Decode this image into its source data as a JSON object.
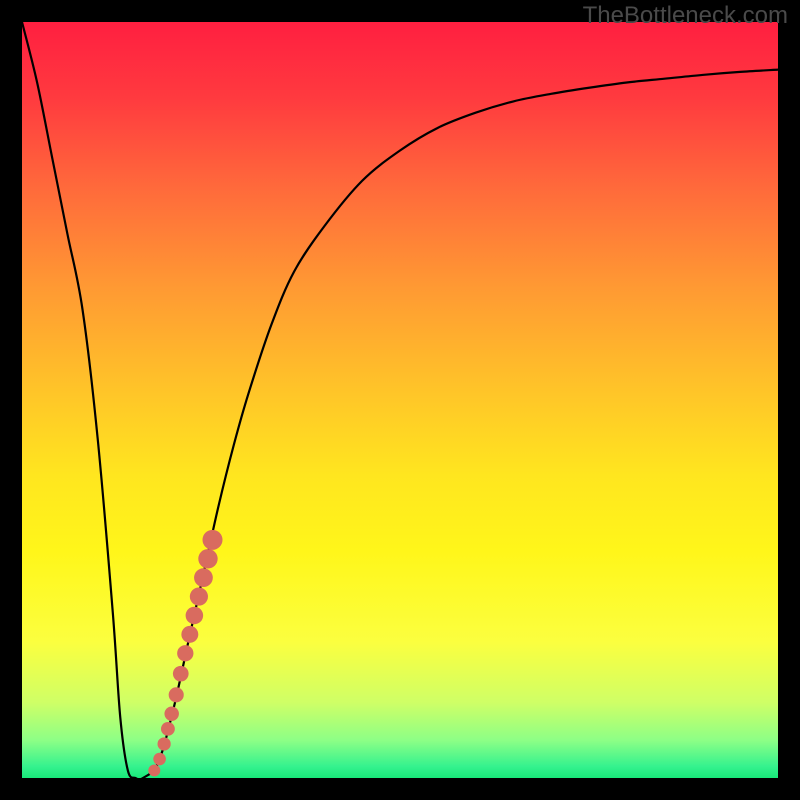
{
  "watermark": "TheBottleneck.com",
  "colors": {
    "page_bg": "#000000",
    "watermark": "#4a4a4a",
    "curve": "#000000",
    "marker": "#d96b5f",
    "gradient_stops": [
      {
        "offset": 0.0,
        "color": "#ff1f40"
      },
      {
        "offset": 0.1,
        "color": "#ff3a3f"
      },
      {
        "offset": 0.22,
        "color": "#ff6a3b"
      },
      {
        "offset": 0.35,
        "color": "#ff9933"
      },
      {
        "offset": 0.48,
        "color": "#ffc229"
      },
      {
        "offset": 0.6,
        "color": "#ffe61f"
      },
      {
        "offset": 0.7,
        "color": "#fff61a"
      },
      {
        "offset": 0.82,
        "color": "#fbff3f"
      },
      {
        "offset": 0.9,
        "color": "#cfff66"
      },
      {
        "offset": 0.95,
        "color": "#8dff86"
      },
      {
        "offset": 0.985,
        "color": "#34f28e"
      },
      {
        "offset": 1.0,
        "color": "#18e879"
      }
    ]
  },
  "chart_data": {
    "type": "line",
    "title": "",
    "xlabel": "",
    "ylabel": "",
    "xlim": [
      0,
      100
    ],
    "ylim": [
      0,
      100
    ],
    "grid": false,
    "legend": false,
    "series": [
      {
        "name": "bottleneck-curve",
        "x": [
          0,
          2,
          4,
          6,
          8,
          10,
          12,
          13,
          14,
          15,
          16,
          18,
          20,
          22,
          24,
          26,
          28,
          30,
          33,
          36,
          40,
          45,
          50,
          55,
          60,
          65,
          70,
          75,
          80,
          85,
          90,
          95,
          100
        ],
        "y": [
          100,
          92,
          82,
          72,
          62,
          45,
          22,
          8,
          1,
          0,
          0,
          2,
          9,
          18,
          27,
          36,
          44,
          51,
          60,
          67,
          73,
          79,
          83,
          86,
          88,
          89.5,
          90.5,
          91.3,
          92,
          92.5,
          93,
          93.4,
          93.7
        ]
      }
    ],
    "markers": {
      "name": "highlight-dots",
      "color": "#d96b5f",
      "points": [
        {
          "x": 17.5,
          "y": 1.0
        },
        {
          "x": 18.2,
          "y": 2.5
        },
        {
          "x": 18.8,
          "y": 4.5
        },
        {
          "x": 19.3,
          "y": 6.5
        },
        {
          "x": 19.8,
          "y": 8.5
        },
        {
          "x": 20.4,
          "y": 11.0
        },
        {
          "x": 21.0,
          "y": 13.8
        },
        {
          "x": 21.6,
          "y": 16.5
        },
        {
          "x": 22.2,
          "y": 19.0
        },
        {
          "x": 22.8,
          "y": 21.5
        },
        {
          "x": 23.4,
          "y": 24.0
        },
        {
          "x": 24.0,
          "y": 26.5
        },
        {
          "x": 24.6,
          "y": 29.0
        },
        {
          "x": 25.2,
          "y": 31.5
        }
      ]
    }
  }
}
